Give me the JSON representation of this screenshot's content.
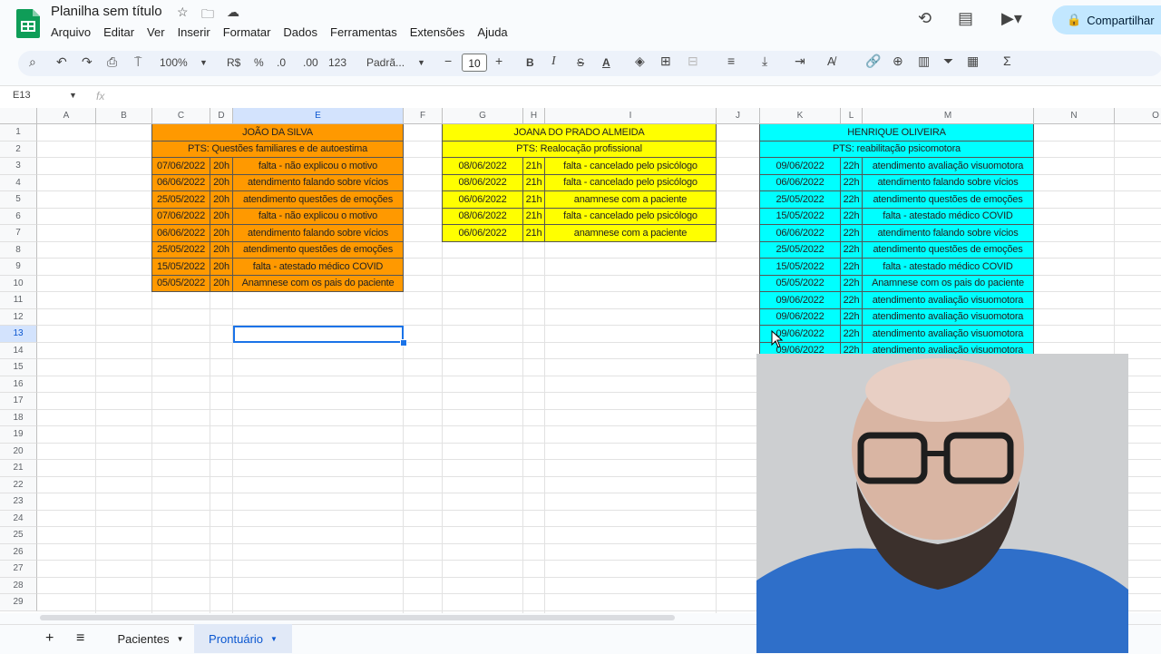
{
  "doc": {
    "title": "Planilha sem título"
  },
  "menu": [
    "Arquivo",
    "Editar",
    "Ver",
    "Inserir",
    "Formatar",
    "Dados",
    "Ferramentas",
    "Extensões",
    "Ajuda"
  ],
  "share_label": "Compartilhar",
  "toolbar": {
    "zoom": "100%",
    "currency": "R$",
    "percent": "%",
    "dec_minus": ".0",
    "dec_plus": ".00",
    "number_format": "123",
    "font": "Padrã...",
    "font_size": "10",
    "bold": "B",
    "italic": "I",
    "strike": "S",
    "text_color": "A"
  },
  "formula": {
    "namebox": "E13",
    "fx": "fx"
  },
  "columns": [
    "A",
    "B",
    "C",
    "D",
    "E",
    "F",
    "G",
    "H",
    "I",
    "J",
    "K",
    "L",
    "M",
    "N",
    "O"
  ],
  "rows": [
    "1",
    "2",
    "3",
    "4",
    "5",
    "6",
    "7",
    "8",
    "9",
    "10",
    "11",
    "12",
    "13",
    "14",
    "15",
    "16",
    "17",
    "18",
    "19",
    "20",
    "21",
    "22",
    "23",
    "24",
    "25",
    "26",
    "27",
    "28",
    "29"
  ],
  "colors": {
    "orange": "#ff9900",
    "yellow": "#ffff00",
    "cyan": "#00ffff",
    "accent": "#1a73e8"
  },
  "patients": [
    {
      "name": "JOÃO DA SILVA",
      "pts": "PTS: Questões familiares e de autoestima",
      "color": "#ff9900",
      "records": [
        {
          "date": "07/06/2022",
          "hour": "20h",
          "desc": "falta - não explicou o motivo"
        },
        {
          "date": "06/06/2022",
          "hour": "20h",
          "desc": "atendimento falando sobre vícios"
        },
        {
          "date": "25/05/2022",
          "hour": "20h",
          "desc": "atendimento questões de emoções"
        },
        {
          "date": "07/06/2022",
          "hour": "20h",
          "desc": "falta - não explicou o motivo"
        },
        {
          "date": "06/06/2022",
          "hour": "20h",
          "desc": "atendimento falando sobre vícios"
        },
        {
          "date": "25/05/2022",
          "hour": "20h",
          "desc": "atendimento questões de emoções"
        },
        {
          "date": "15/05/2022",
          "hour": "20h",
          "desc": "falta - atestado médico COVID"
        },
        {
          "date": "05/05/2022",
          "hour": "20h",
          "desc": "Anamnese com os pais do paciente"
        }
      ]
    },
    {
      "name": "JOANA DO PRADO ALMEIDA",
      "pts": "PTS: Realocação profissional",
      "color": "#ffff00",
      "records": [
        {
          "date": "08/06/2022",
          "hour": "21h",
          "desc": "falta - cancelado pelo psicólogo"
        },
        {
          "date": "08/06/2022",
          "hour": "21h",
          "desc": "falta - cancelado pelo psicólogo"
        },
        {
          "date": "06/06/2022",
          "hour": "21h",
          "desc": "anamnese com a paciente"
        },
        {
          "date": "08/06/2022",
          "hour": "21h",
          "desc": "falta - cancelado pelo psicólogo"
        },
        {
          "date": "06/06/2022",
          "hour": "21h",
          "desc": "anamnese com a paciente"
        }
      ]
    },
    {
      "name": "HENRIQUE OLIVEIRA",
      "pts": "PTS: reabilitação psicomotora",
      "color": "#00ffff",
      "records": [
        {
          "date": "09/06/2022",
          "hour": "22h",
          "desc": "atendimento avaliação visuomotora"
        },
        {
          "date": "06/06/2022",
          "hour": "22h",
          "desc": "atendimento falando sobre vícios"
        },
        {
          "date": "25/05/2022",
          "hour": "22h",
          "desc": "atendimento questões de emoções"
        },
        {
          "date": "15/05/2022",
          "hour": "22h",
          "desc": "falta - atestado médico COVID"
        },
        {
          "date": "06/06/2022",
          "hour": "22h",
          "desc": "atendimento falando sobre vícios"
        },
        {
          "date": "25/05/2022",
          "hour": "22h",
          "desc": "atendimento questões de emoções"
        },
        {
          "date": "15/05/2022",
          "hour": "22h",
          "desc": "falta - atestado médico COVID"
        },
        {
          "date": "05/05/2022",
          "hour": "22h",
          "desc": "Anamnese com os pais do paciente"
        },
        {
          "date": "09/06/2022",
          "hour": "22h",
          "desc": "atendimento avaliação visuomotora"
        },
        {
          "date": "09/06/2022",
          "hour": "22h",
          "desc": "atendimento avaliação visuomotora"
        },
        {
          "date": "09/06/2022",
          "hour": "22h",
          "desc": "atendimento avaliação visuomotora"
        },
        {
          "date": "09/06/2022",
          "hour": "22h",
          "desc": "atendimento avaliação visuomotora"
        }
      ]
    }
  ],
  "sheets": {
    "add": "+",
    "list": "≡",
    "tabs": [
      {
        "label": "Pacientes",
        "active": false
      },
      {
        "label": "Prontuário",
        "active": true
      }
    ]
  }
}
